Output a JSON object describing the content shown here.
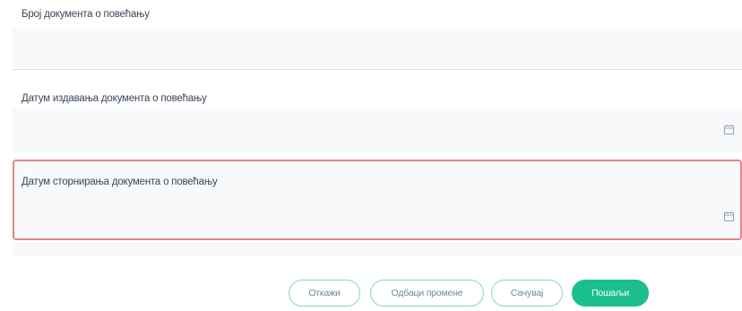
{
  "form": {
    "fields": [
      {
        "label": "Број документа о повећању",
        "value": ""
      },
      {
        "label": "Датум издавања документа о повећању",
        "value": ""
      },
      {
        "label": "Датум сторнирања документа о повећању",
        "value": ""
      }
    ]
  },
  "actions": {
    "cancel_label": "Откажи",
    "discard_label": "Одбаци промене",
    "save_label": "Сачувај",
    "send_label": "Пошаљи"
  },
  "colors": {
    "primary": "#1bbf8e",
    "outline": "#86d6c0",
    "error_border": "#e4868b",
    "field_bg": "#f7f9fb"
  },
  "icons": [
    "calendar-icon"
  ]
}
